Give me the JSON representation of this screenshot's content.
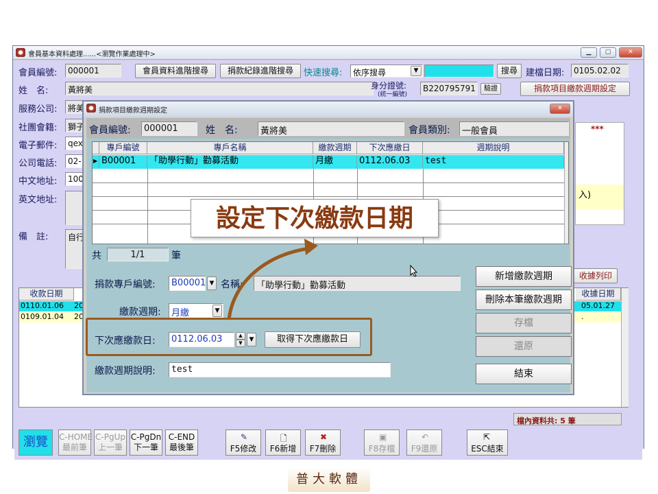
{
  "main_window": {
    "title": "會員基本資料處理......<瀏覽作業處理中>",
    "fields": {
      "member_no_label": "會員編號:",
      "member_no": "000001",
      "name_label": "姓　名:",
      "name": "黃將美",
      "company_label": "服務公司:",
      "company": "將美",
      "club_label": "社團會籍:",
      "club": "獅子",
      "email_label": "電子郵件:",
      "email": "qex",
      "phone_label": "公司電話:",
      "phone": "02-",
      "cn_addr_label": "中文地址:",
      "cn_addr": "100",
      "en_addr_label": "英文地址:",
      "note_label": "備　註:",
      "note": "自行",
      "id_label": "身分證號:",
      "id_sub_label": "(統一編號)",
      "id_value": "B220795791",
      "verify_button": "驗證",
      "created_label": "建檔日期:",
      "created_value": "0105.02.02"
    },
    "buttons": {
      "member_adv_search": "會員資料進階搜尋",
      "donation_adv_search": "捐款紀錄進階搜尋",
      "quick_search_label": "快速搜尋:",
      "quick_search_mode": "依序搜尋",
      "search": "搜尋",
      "cycle_setting": "捐款項目繳款週期設定",
      "receipt_print": "收據列印"
    },
    "right_panel": {
      "stars": "***",
      "yellow_text": "入)"
    },
    "donation_grid": {
      "headers": [
        "收款日期",
        "收據日期"
      ],
      "rows": [
        {
          "date": "0110.01.06",
          "prefix": "20",
          "receipt": "05.01.27"
        },
        {
          "date": "0109.01.04",
          "prefix": "20",
          "receipt": "."
        }
      ]
    },
    "status": "檔內資料共: 5 筆",
    "toolbar": [
      {
        "id": "browse",
        "label": "瀏覽"
      },
      {
        "id": "first",
        "label": "C-HOME\n最前筆"
      },
      {
        "id": "prev",
        "label": "C-PgUp\n上一筆"
      },
      {
        "id": "next",
        "label": "C-PgDn\n下一筆"
      },
      {
        "id": "last",
        "label": "C-END\n最後筆"
      },
      {
        "id": "edit",
        "label": "F5修改"
      },
      {
        "id": "add",
        "label": "F6新增"
      },
      {
        "id": "delete",
        "label": "F7刪除"
      },
      {
        "id": "save",
        "label": "F8存檔"
      },
      {
        "id": "restore",
        "label": "F9還原"
      },
      {
        "id": "exit",
        "label": "ESC結束"
      }
    ]
  },
  "dialog": {
    "title": "捐款項目繳款週期設定",
    "member_no_label": "會員編號:",
    "member_no": "000001",
    "name_label": "姓　名:",
    "name": "黃將美",
    "type_label": "會員類別:",
    "type": "一般會員",
    "grid": {
      "headers": [
        "專戶編號",
        "專戶名稱",
        "繳款週期",
        "下次應繳日",
        "週期說明"
      ],
      "row": [
        "B00001",
        "「助學行動」勸募活動",
        "月繳",
        "0112.06.03",
        "test"
      ]
    },
    "count_prefix": "共",
    "count_value": "1/1",
    "count_suffix": "筆",
    "form": {
      "account_label": "捐款專戶編號:",
      "account_value": "B00001",
      "account_name_label": "名稱:",
      "account_name_value": "「助學行動」勸募活動",
      "cycle_label": "繳款週期:",
      "cycle_value": "月繳",
      "next_date_label": "下次應繳款日:",
      "next_date_value": "0112.06.03",
      "get_next_button": "取得下次應繳款日",
      "desc_label": "繳款週期說明:",
      "desc_value": "test"
    },
    "side_buttons": {
      "add_cycle": "新增繳款週期",
      "delete_cycle": "刪除本筆繳款週期",
      "save": "存檔",
      "restore": "還原",
      "close": "結束"
    }
  },
  "callout": "設定下次繳款日期",
  "footer_logo": "普大軟體"
}
